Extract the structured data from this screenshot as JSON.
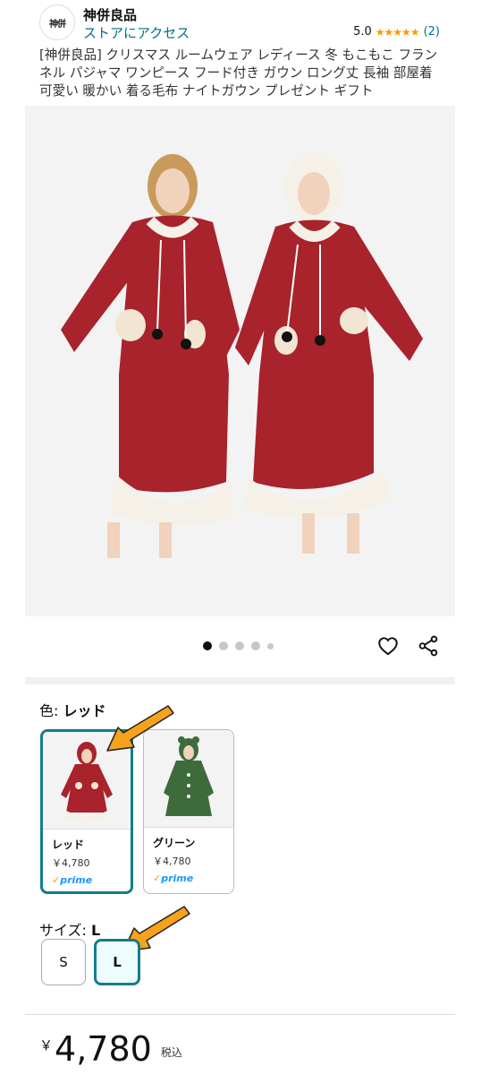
{
  "header": {
    "store_name": "神併良品",
    "store_link": "ストアにアクセス",
    "logo_text": "神併",
    "rating_value": "5.0",
    "rating_stars": "★★★★★",
    "rating_count": "(2)"
  },
  "product": {
    "title": "[神併良品] クリスマス ルームウェア レディース 冬 もこもこ フランネル パジャマ ワンピース フード付き ガウン ロング丈 長袖 部屋着 可愛い 暖かい 着る毛布 ナイトガウン プレゼント ギフト"
  },
  "carousel": {
    "count": 5,
    "active_index": 0
  },
  "color": {
    "label": "色: ",
    "selected": "レッド",
    "options": [
      {
        "name": "レッド",
        "price": "￥4,780",
        "prime": "prime"
      },
      {
        "name": "グリーン",
        "price": "￥4,780",
        "prime": "prime"
      }
    ]
  },
  "size": {
    "label": "サイズ: ",
    "selected": "L",
    "options": [
      "S",
      "L"
    ]
  },
  "price": {
    "currency": "￥",
    "amount": "4,780",
    "tax": "税込"
  },
  "colors": {
    "accent": "#147c8f",
    "link": "#007185",
    "star": "#ff9900",
    "arrow": "#f7a21b",
    "robe_red": "#a8232c",
    "robe_green": "#3e6b3a"
  }
}
